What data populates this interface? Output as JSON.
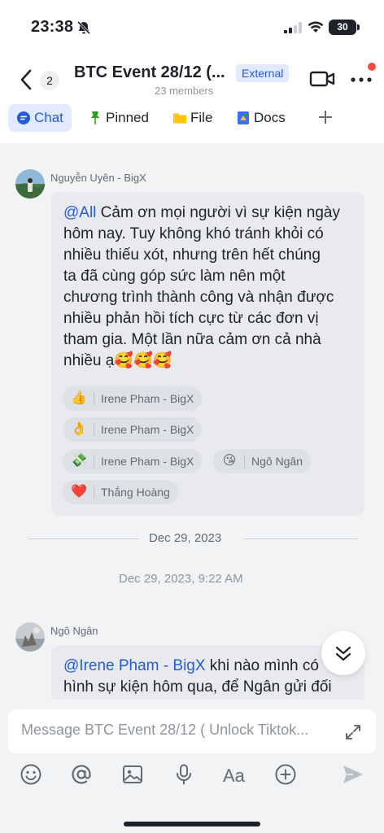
{
  "status": {
    "time": "23:38",
    "battery": "30"
  },
  "header": {
    "back_count": "2",
    "title": "BTC Event 28/12 (...",
    "badge": "External",
    "members": "23 members"
  },
  "tabs": [
    {
      "label": "Chat",
      "icon": "chat-bubble-icon",
      "active": true
    },
    {
      "label": "Pinned",
      "icon": "pin-icon"
    },
    {
      "label": "File",
      "icon": "folder-icon"
    },
    {
      "label": "Docs",
      "icon": "docs-icon"
    }
  ],
  "messages": [
    {
      "sender": "Nguyễn Uyên - BigX",
      "mention": "@All",
      "lines": [
        " Cảm ơn mọi người vì sự kiện ngày",
        "hôm nay. Tuy không khó tránh khỏi có",
        "nhiều thiếu xót, nhưng trên hết chúng",
        "ta đã cùng góp sức làm nên một",
        "chương trình thành công và nhận được",
        "nhiều phản hồi tích cực từ các đơn vị",
        "tham gia. Một lần nữa cảm ơn cả nhà",
        "nhiều ạ🥰🥰🥰"
      ],
      "reactions": [
        {
          "emoji": "👍",
          "name": "Irene Pham - BigX"
        },
        {
          "emoji": "👌",
          "name": "Irene Pham - BigX"
        },
        {
          "emoji": "💸",
          "name": "Irene Pham - BigX"
        },
        {
          "emoji": "😘",
          "name": "Ngô Ngân"
        },
        {
          "emoji": "❤️",
          "name": "Thắng Hoàng"
        }
      ]
    },
    {
      "sender": "Ngô Ngân",
      "mention": "@Irene Pham - BigX",
      "line1_rest": " khi nào mình có",
      "line2": "hình sự kiện hôm qua, để Ngân gửi đối"
    }
  ],
  "date_divider": "Dec 29, 2023",
  "timestamp": "Dec 29, 2023, 9:22 AM",
  "composer": {
    "placeholder": "Message BTC Event 28/12 ( Unlock Tiktok...",
    "tools": [
      "emoji-icon",
      "at-icon",
      "image-icon",
      "mic-icon",
      "text-format-icon",
      "plus-icon",
      "send-icon"
    ]
  },
  "colors": {
    "accent": "#245bdb",
    "tab_active_bg": "#e1eaff",
    "badge_dot": "#f54a45"
  }
}
